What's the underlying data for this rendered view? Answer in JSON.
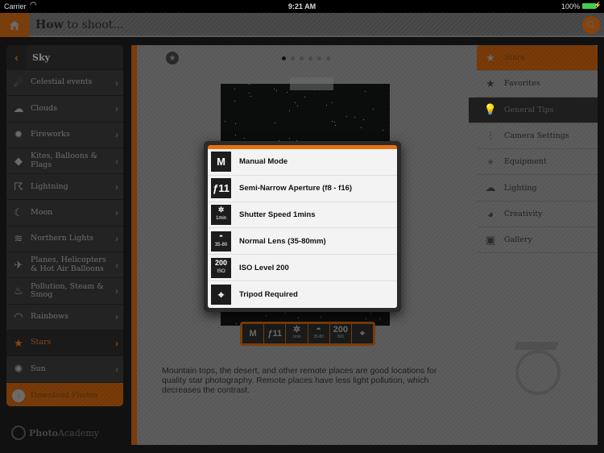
{
  "status_bar": {
    "carrier": "Carrier",
    "time": "9:21 AM",
    "battery": "100%",
    "battery_color": "#3ecf4d"
  },
  "header": {
    "title_bold": "How",
    "title_rest": " to shoot..."
  },
  "left_sidebar": {
    "title": "Sky",
    "items": [
      {
        "label": "Celestial events",
        "icon": "comet-icon",
        "glyph": "☄"
      },
      {
        "label": "Clouds",
        "icon": "cloud-icon",
        "glyph": "☁"
      },
      {
        "label": "Fireworks",
        "icon": "fireworks-icon",
        "glyph": "✹"
      },
      {
        "label": "Kites, Balloons & Flags",
        "icon": "kite-icon",
        "glyph": "◆"
      },
      {
        "label": "Lightning",
        "icon": "lightning-icon",
        "glyph": "☈"
      },
      {
        "label": "Moon",
        "icon": "moon-icon",
        "glyph": "☾"
      },
      {
        "label": "Northern Lights",
        "icon": "aurora-icon",
        "glyph": "≋"
      },
      {
        "label": "Planes, Helicopters & Hot Air Balloons",
        "icon": "plane-icon",
        "glyph": "✈"
      },
      {
        "label": "Pollution, Steam & Smog",
        "icon": "smokestack-icon",
        "glyph": "♨"
      },
      {
        "label": "Rainbows",
        "icon": "rainbow-icon",
        "glyph": "◠"
      },
      {
        "label": "Stars",
        "icon": "star-icon",
        "glyph": "★",
        "active": true
      },
      {
        "label": "Sun",
        "icon": "sun-icon",
        "glyph": "✺"
      }
    ],
    "download_label": "Download Photos"
  },
  "brand": {
    "bold": "Photo",
    "rest": "Academy"
  },
  "main": {
    "page_count": 6,
    "current_page": 1,
    "description": "Mountain tops, the desert, and other remote places are good locations for quality star photography. Remote places have less light pollution, which decreases the contrast.",
    "settings_bar": [
      {
        "main": "M",
        "sub": ""
      },
      {
        "main": "ƒ11",
        "sub": ""
      },
      {
        "main": "✲",
        "sub": "1min"
      },
      {
        "main": "◓",
        "sub": "35-80"
      },
      {
        "main": "200",
        "sub": "ISO"
      },
      {
        "main": "⌖",
        "sub": ""
      }
    ]
  },
  "popup": {
    "accent": "#e8710e",
    "rows": [
      {
        "icon_main": "M",
        "icon_sub": "",
        "label": "Manual Mode",
        "icon": "manual-mode-icon"
      },
      {
        "icon_main": "ƒ11",
        "icon_sub": "",
        "label": "Semi-Narrow Aperture (f8 - f16)",
        "icon": "aperture-icon"
      },
      {
        "icon_main": "✲",
        "icon_sub": "1min",
        "label": "Shutter Speed 1mins",
        "icon": "shutter-icon"
      },
      {
        "icon_main": "◓",
        "icon_sub": "35-80",
        "label": "Normal Lens (35-80mm)",
        "icon": "lens-icon"
      },
      {
        "icon_main": "200",
        "icon_sub": "ISO",
        "label": "ISO Level 200",
        "icon": "iso-icon"
      },
      {
        "icon_main": "⌖",
        "icon_sub": "",
        "label": "Tripod Required",
        "icon": "tripod-icon"
      }
    ]
  },
  "right_sidebar": {
    "items": [
      {
        "label": "Stars",
        "icon": "star-icon",
        "glyph": "★",
        "state": "selected"
      },
      {
        "label": "Favorites",
        "icon": "favorites-star-icon",
        "glyph": "★"
      },
      {
        "label": "General Tips",
        "icon": "lightbulb-icon",
        "glyph": "💡",
        "state": "active"
      },
      {
        "label": "Camera Settings",
        "icon": "sliders-icon",
        "glyph": "⫶"
      },
      {
        "label": "Equipment",
        "icon": "tripod-camera-icon",
        "glyph": "⌖"
      },
      {
        "label": "Lighting",
        "icon": "weather-icon",
        "glyph": "☁"
      },
      {
        "label": "Creativity",
        "icon": "palette-icon",
        "glyph": "◕"
      },
      {
        "label": "Gallery",
        "icon": "picture-frame-icon",
        "glyph": "▣"
      }
    ]
  }
}
